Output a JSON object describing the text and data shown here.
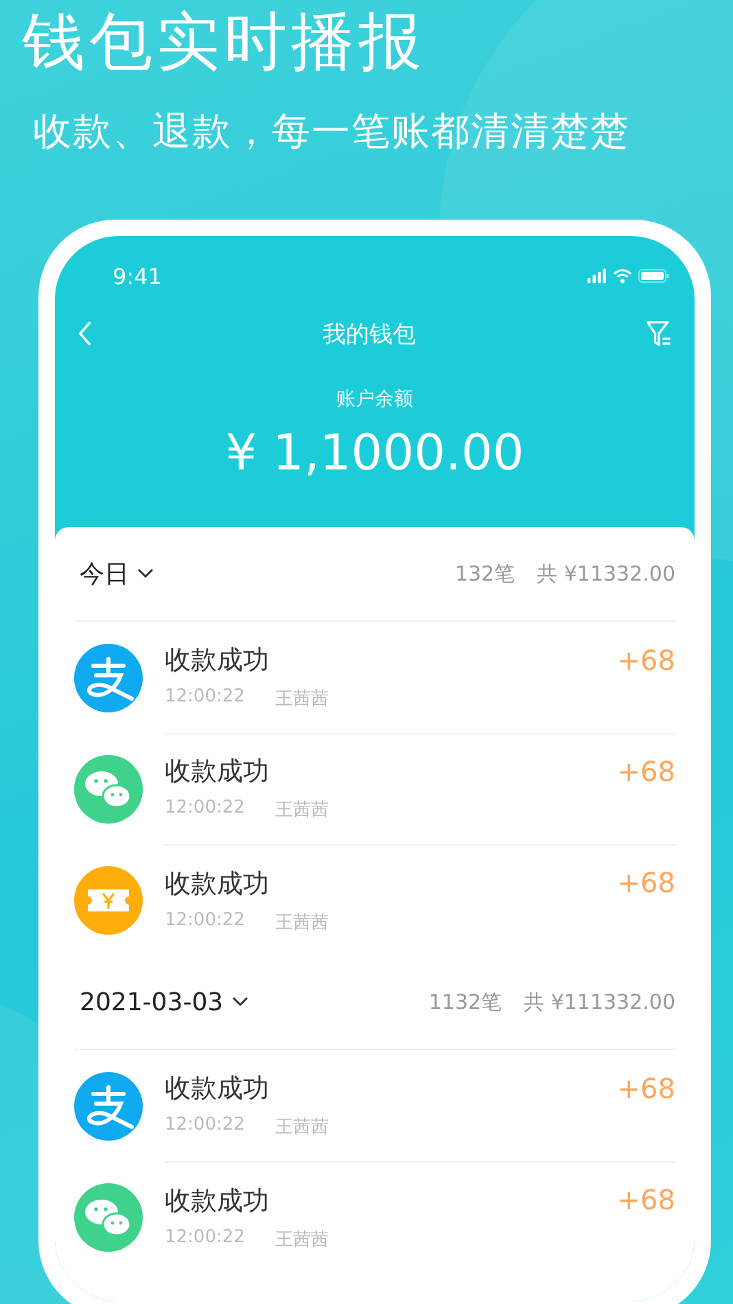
{
  "headline": "钱包实时播报",
  "subheadline": "收款、退款，每一笔账都清清楚楚",
  "status_bar": {
    "time": "9:41"
  },
  "nav": {
    "title": "我的钱包"
  },
  "balance": {
    "label": "账户余额",
    "amount": "¥ 1,1000.00"
  },
  "sections": [
    {
      "date": "今日",
      "count": "132笔",
      "total": "共 ¥11332.00",
      "rows": [
        {
          "kind": "alipay",
          "title": "收款成功",
          "time": "12:00:22",
          "name": "王茜茜",
          "amount": "+68"
        },
        {
          "kind": "wechat",
          "title": "收款成功",
          "time": "12:00:22",
          "name": "王茜茜",
          "amount": "+68"
        },
        {
          "kind": "voucher",
          "title": "收款成功",
          "time": "12:00:22",
          "name": "王茜茜",
          "amount": "+68"
        }
      ]
    },
    {
      "date": "2021-03-03",
      "count": "1132笔",
      "total": "共 ¥111332.00",
      "rows": [
        {
          "kind": "alipay",
          "title": "收款成功",
          "time": "12:00:22",
          "name": "王茜茜",
          "amount": "+68"
        },
        {
          "kind": "wechat",
          "title": "收款成功",
          "time": "12:00:22",
          "name": "王茜茜",
          "amount": "+68"
        }
      ]
    }
  ]
}
